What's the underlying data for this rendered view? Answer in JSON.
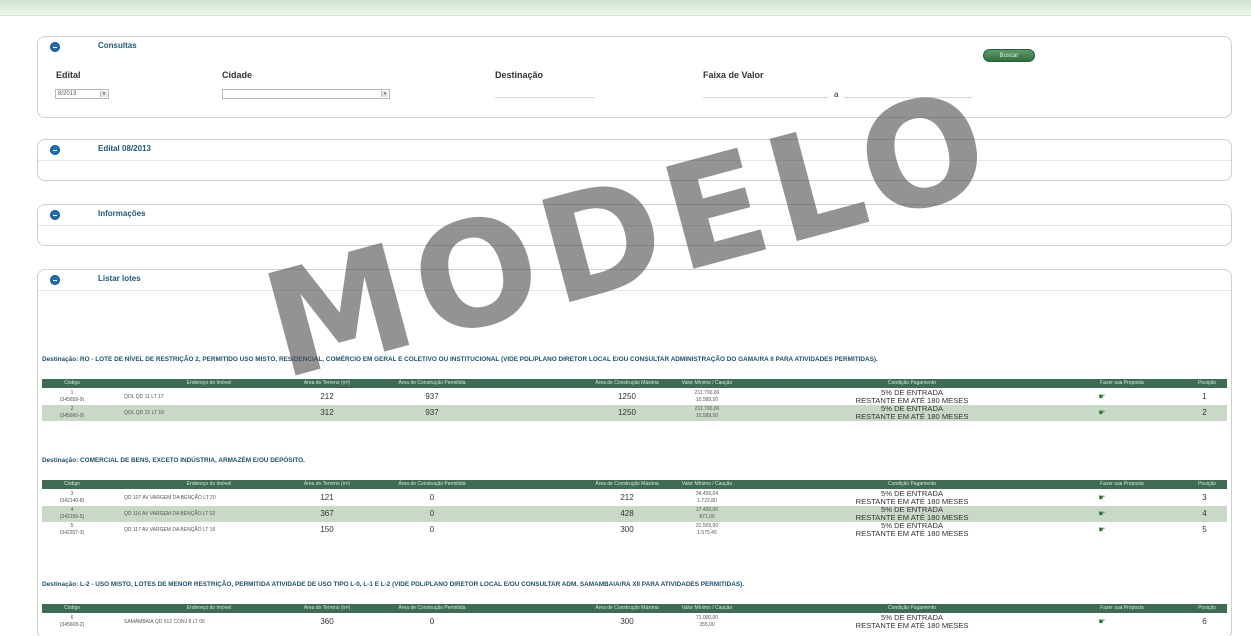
{
  "panels": {
    "consultas": "Consultas",
    "edital_panel": "Edital 08/2013",
    "informacoes": "Informações",
    "listar_lotes": "Listar lotes"
  },
  "form": {
    "edital_label": "Edital",
    "edital_value": "8/2013",
    "cidade_label": "Cidade",
    "cidade_value": "",
    "destinacao_label": "Destinação",
    "faixa_label": "Faixa de Valor",
    "faixa_sep": "a",
    "search_button": "Buscar"
  },
  "columns": [
    "Código",
    "Endereço do Imóvel",
    "Área do Terreno (m²)",
    "Área de Construção Permitida",
    "Área de Construção Máxima",
    "Valor Mínimo / Caução",
    "Condição Pagamento",
    "Fazer sua Proposta",
    "Posição"
  ],
  "groups": [
    {
      "heading": "Destinação: RO - LOTE DE NÍVEL DE RESTRIÇÃO 2, PERMITIDO USO MISTO, RESIDENCIAL, COMÉRCIO EM GERAL E COLETIVO OU INSTITUCIONAL (VIDE PDL/PLANO DIRETOR LOCAL E/OU CONSULTAR ADMINISTRAÇÃO DO GAMA/RA II PARA ATIVIDADES PERMITIDAS).",
      "rows": [
        {
          "code": "1",
          "code2": "(345658-9)",
          "address": "QOL QD 11 LT 17",
          "a1": "212",
          "a2": "937",
          "a3": "1250",
          "val": "211.790,00",
          "val2": "10.589,50",
          "cond1": "5% DE ENTRADA",
          "cond2": "RESTANTE EM ATÉ 180 MESES",
          "order": "1"
        },
        {
          "code": "2",
          "code2": "(345660-9)",
          "address": "QOL QD 12 LT 18",
          "a1": "312",
          "a2": "937",
          "a3": "1250",
          "val": "211.790,00",
          "val2": "10.589,50",
          "cond1": "5% DE ENTRADA",
          "cond2": "RESTANTE EM ATÉ 180 MESES",
          "order": "2"
        }
      ]
    },
    {
      "heading": "Destinação: COMERCIAL DE BENS, EXCETO INDÚSTRIA, ARMAZÉM E/OU DEPÓSITO.",
      "rows": [
        {
          "code": "3",
          "code2": "(342140-8)",
          "address": "QD 107 AV VARGEM DA BENÇÃO LT 20",
          "a1": "121",
          "a2": "0",
          "a3": "212",
          "val": "34.456,04",
          "val2": "1.722,80",
          "cond1": "5% DE ENTRADA",
          "cond2": "RESTANTE EM ATÉ 180 MESES",
          "order": "3"
        },
        {
          "code": "4",
          "code2": "(342156-5)",
          "address": "QD 116 AV VARGEM DA BENÇÃO LT 02",
          "a1": "367",
          "a2": "0",
          "a3": "428",
          "val": "17.420,00",
          "val2": "871,00",
          "cond1": "5% DE ENTRADA",
          "cond2": "RESTANTE EM ATÉ 180 MESES",
          "order": "4"
        },
        {
          "code": "5",
          "code2": "(342207-3)",
          "address": "QD 117 AV VARGEM DA BENÇÃO LT 16",
          "a1": "150",
          "a2": "0",
          "a3": "300",
          "val": "31.509,00",
          "val2": "1.575,45",
          "cond1": "5% DE ENTRADA",
          "cond2": "RESTANTE EM ATÉ 180 MESES",
          "order": "5"
        }
      ]
    },
    {
      "heading": "Destinação: L-2 - USO MISTO, LOTES DE MENOR RESTRIÇÃO, PERMITIDA ATIVIDADE DE USO TIPO L-0, L-1 E L-2 (VIDE PDL/PLANO DIRETOR LOCAL E/OU CONSULTAR ADM. SAMAMBAIA/RA XII PARA ATIVIDADES PERMITIDAS).",
      "rows": [
        {
          "code": "6",
          "code2": "(345608-2)",
          "address": "SAMAMBAIA QD 512 CONJ 8 LT 06",
          "a1": "360",
          "a2": "0",
          "a3": "300",
          "val": "71.000,00",
          "val2": "355,00",
          "cond1": "5% DE ENTRADA",
          "cond2": "RESTANTE EM ATÉ 180 MESES",
          "order": "6"
        }
      ]
    }
  ],
  "watermark": "MODELO",
  "icons": {
    "toggle": "circle-toggle-icon",
    "proposal": "pointing-hand-icon"
  }
}
